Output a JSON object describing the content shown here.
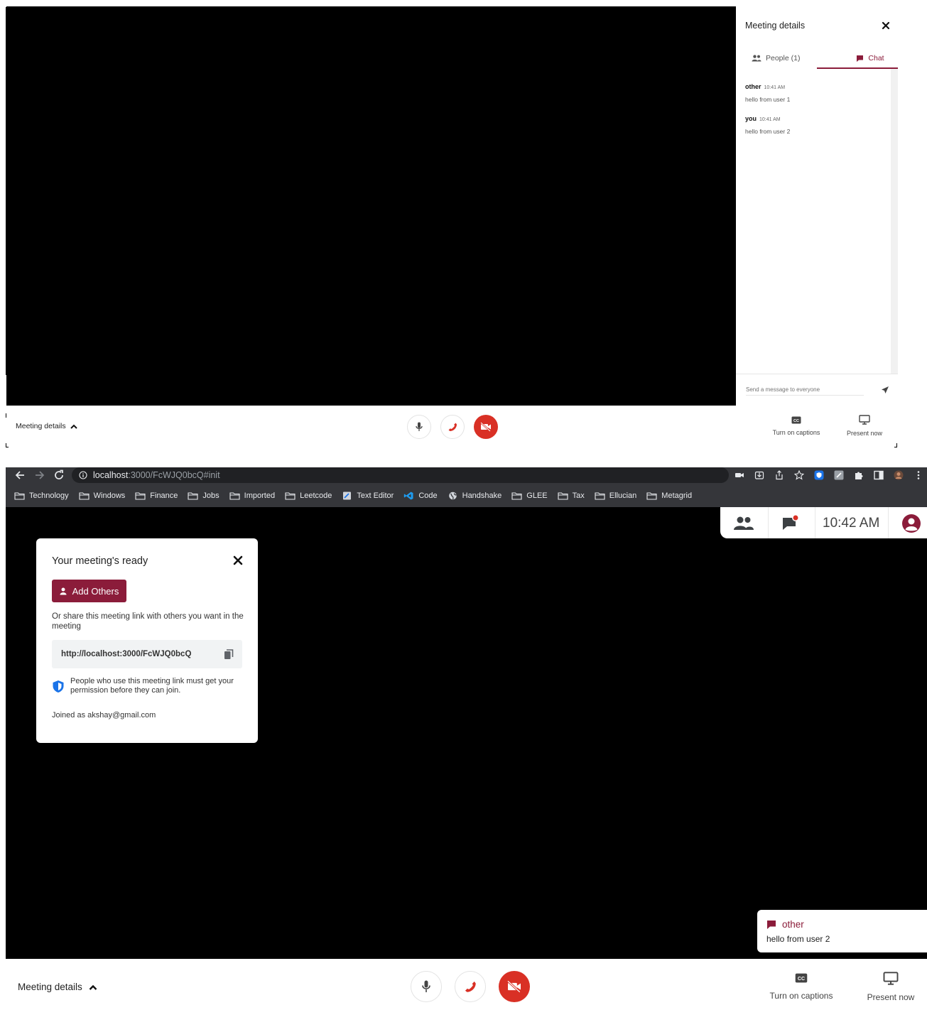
{
  "top_panel": {
    "side": {
      "title": "Meeting details",
      "tab_people": "People (1)",
      "tab_chat": "Chat",
      "messages": [
        {
          "sender": "other",
          "time": "10:41 AM",
          "text": "hello from user 1"
        },
        {
          "sender": "you",
          "time": "10:41 AM",
          "text": "hello from user 2"
        }
      ],
      "input_placeholder": "Send a message to everyone"
    },
    "toolbar": {
      "meeting_details": "Meeting details",
      "captions": "Turn on captions",
      "present": "Present now"
    }
  },
  "browser": {
    "url_host": "localhost",
    "url_path": ":3000/FcWJQ0bcQ#init",
    "bookmarks": [
      "Technology",
      "Windows",
      "Finance",
      "Jobs",
      "Imported",
      "Leetcode",
      "Text Editor",
      "Code",
      "Handshake",
      "GLEE",
      "Tax",
      "Ellucian",
      "Metagrid"
    ]
  },
  "meeting": {
    "time": "10:42 AM",
    "ready_card": {
      "title": "Your meeting's ready",
      "add_button": "Add Others",
      "share_text": "Or share this meeting link with others you want in the meeting",
      "link": "http://localhost:3000/FcWJQ0bcQ",
      "permission_text": "People who use this meeting link must get your permission before they can join.",
      "joined_text": "Joined as akshay@gmail.com"
    },
    "toast": {
      "sender": "other",
      "message": "hello from user 2"
    },
    "toolbar": {
      "meeting_details": "Meeting details",
      "captions": "Turn on captions",
      "present": "Present now"
    }
  },
  "colors": {
    "accent": "#8b1c3a",
    "danger": "#d93025",
    "chrome_bg": "#35363a",
    "link_blue": "#1a73e8"
  }
}
